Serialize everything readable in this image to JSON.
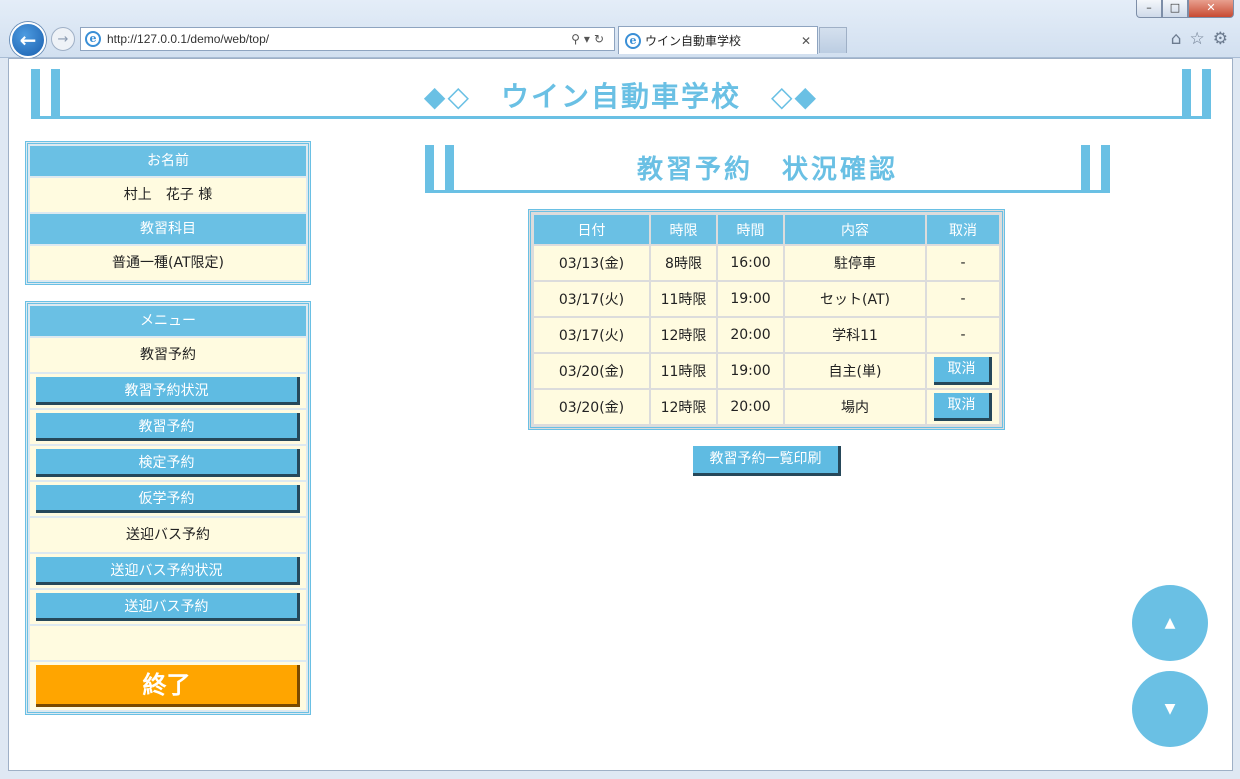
{
  "browser": {
    "url": "http://127.0.0.1/demo/web/top/",
    "tab_title": "ウイン自動車学校"
  },
  "header": {
    "title": "◆◇　ウイン自動車学校　◇◆"
  },
  "user_panel": {
    "name_header": "お名前",
    "name_value": "村上　花子 様",
    "course_header": "教習科目",
    "course_value": "普通一種(AT限定)"
  },
  "menu": {
    "header": "メニュー",
    "section1_label": "教習予約",
    "items1": [
      "教習予約状況",
      "教習予約",
      "検定予約",
      "仮学予約"
    ],
    "section2_label": "送迎バス予約",
    "items2": [
      "送迎バス予約状況",
      "送迎バス予約"
    ],
    "end_label": "終了"
  },
  "main": {
    "section_title": "教習予約　状況確認",
    "table": {
      "headers": [
        "日付",
        "時限",
        "時間",
        "内容",
        "取消"
      ],
      "rows": [
        {
          "date": "03/13(金)",
          "period": "8時限",
          "time": "16:00",
          "content": "駐停車",
          "cancel": "-"
        },
        {
          "date": "03/17(火)",
          "period": "11時限",
          "time": "19:00",
          "content": "セット(AT)",
          "cancel": "-"
        },
        {
          "date": "03/17(火)",
          "period": "12時限",
          "time": "20:00",
          "content": "学科11",
          "cancel": "-"
        },
        {
          "date": "03/20(金)",
          "period": "11時限",
          "time": "19:00",
          "content": "自主(単)",
          "cancel": "取消"
        },
        {
          "date": "03/20(金)",
          "period": "12時限",
          "time": "20:00",
          "content": "場内",
          "cancel": "取消"
        }
      ]
    },
    "print_label": "教習予約一覧印刷"
  },
  "scroll": {
    "up_glyph": "▲",
    "down_glyph": "▼"
  },
  "colors": {
    "accent": "#6ac0e4",
    "cell_bg": "#fffbe0",
    "end_button": "#ffa500"
  }
}
